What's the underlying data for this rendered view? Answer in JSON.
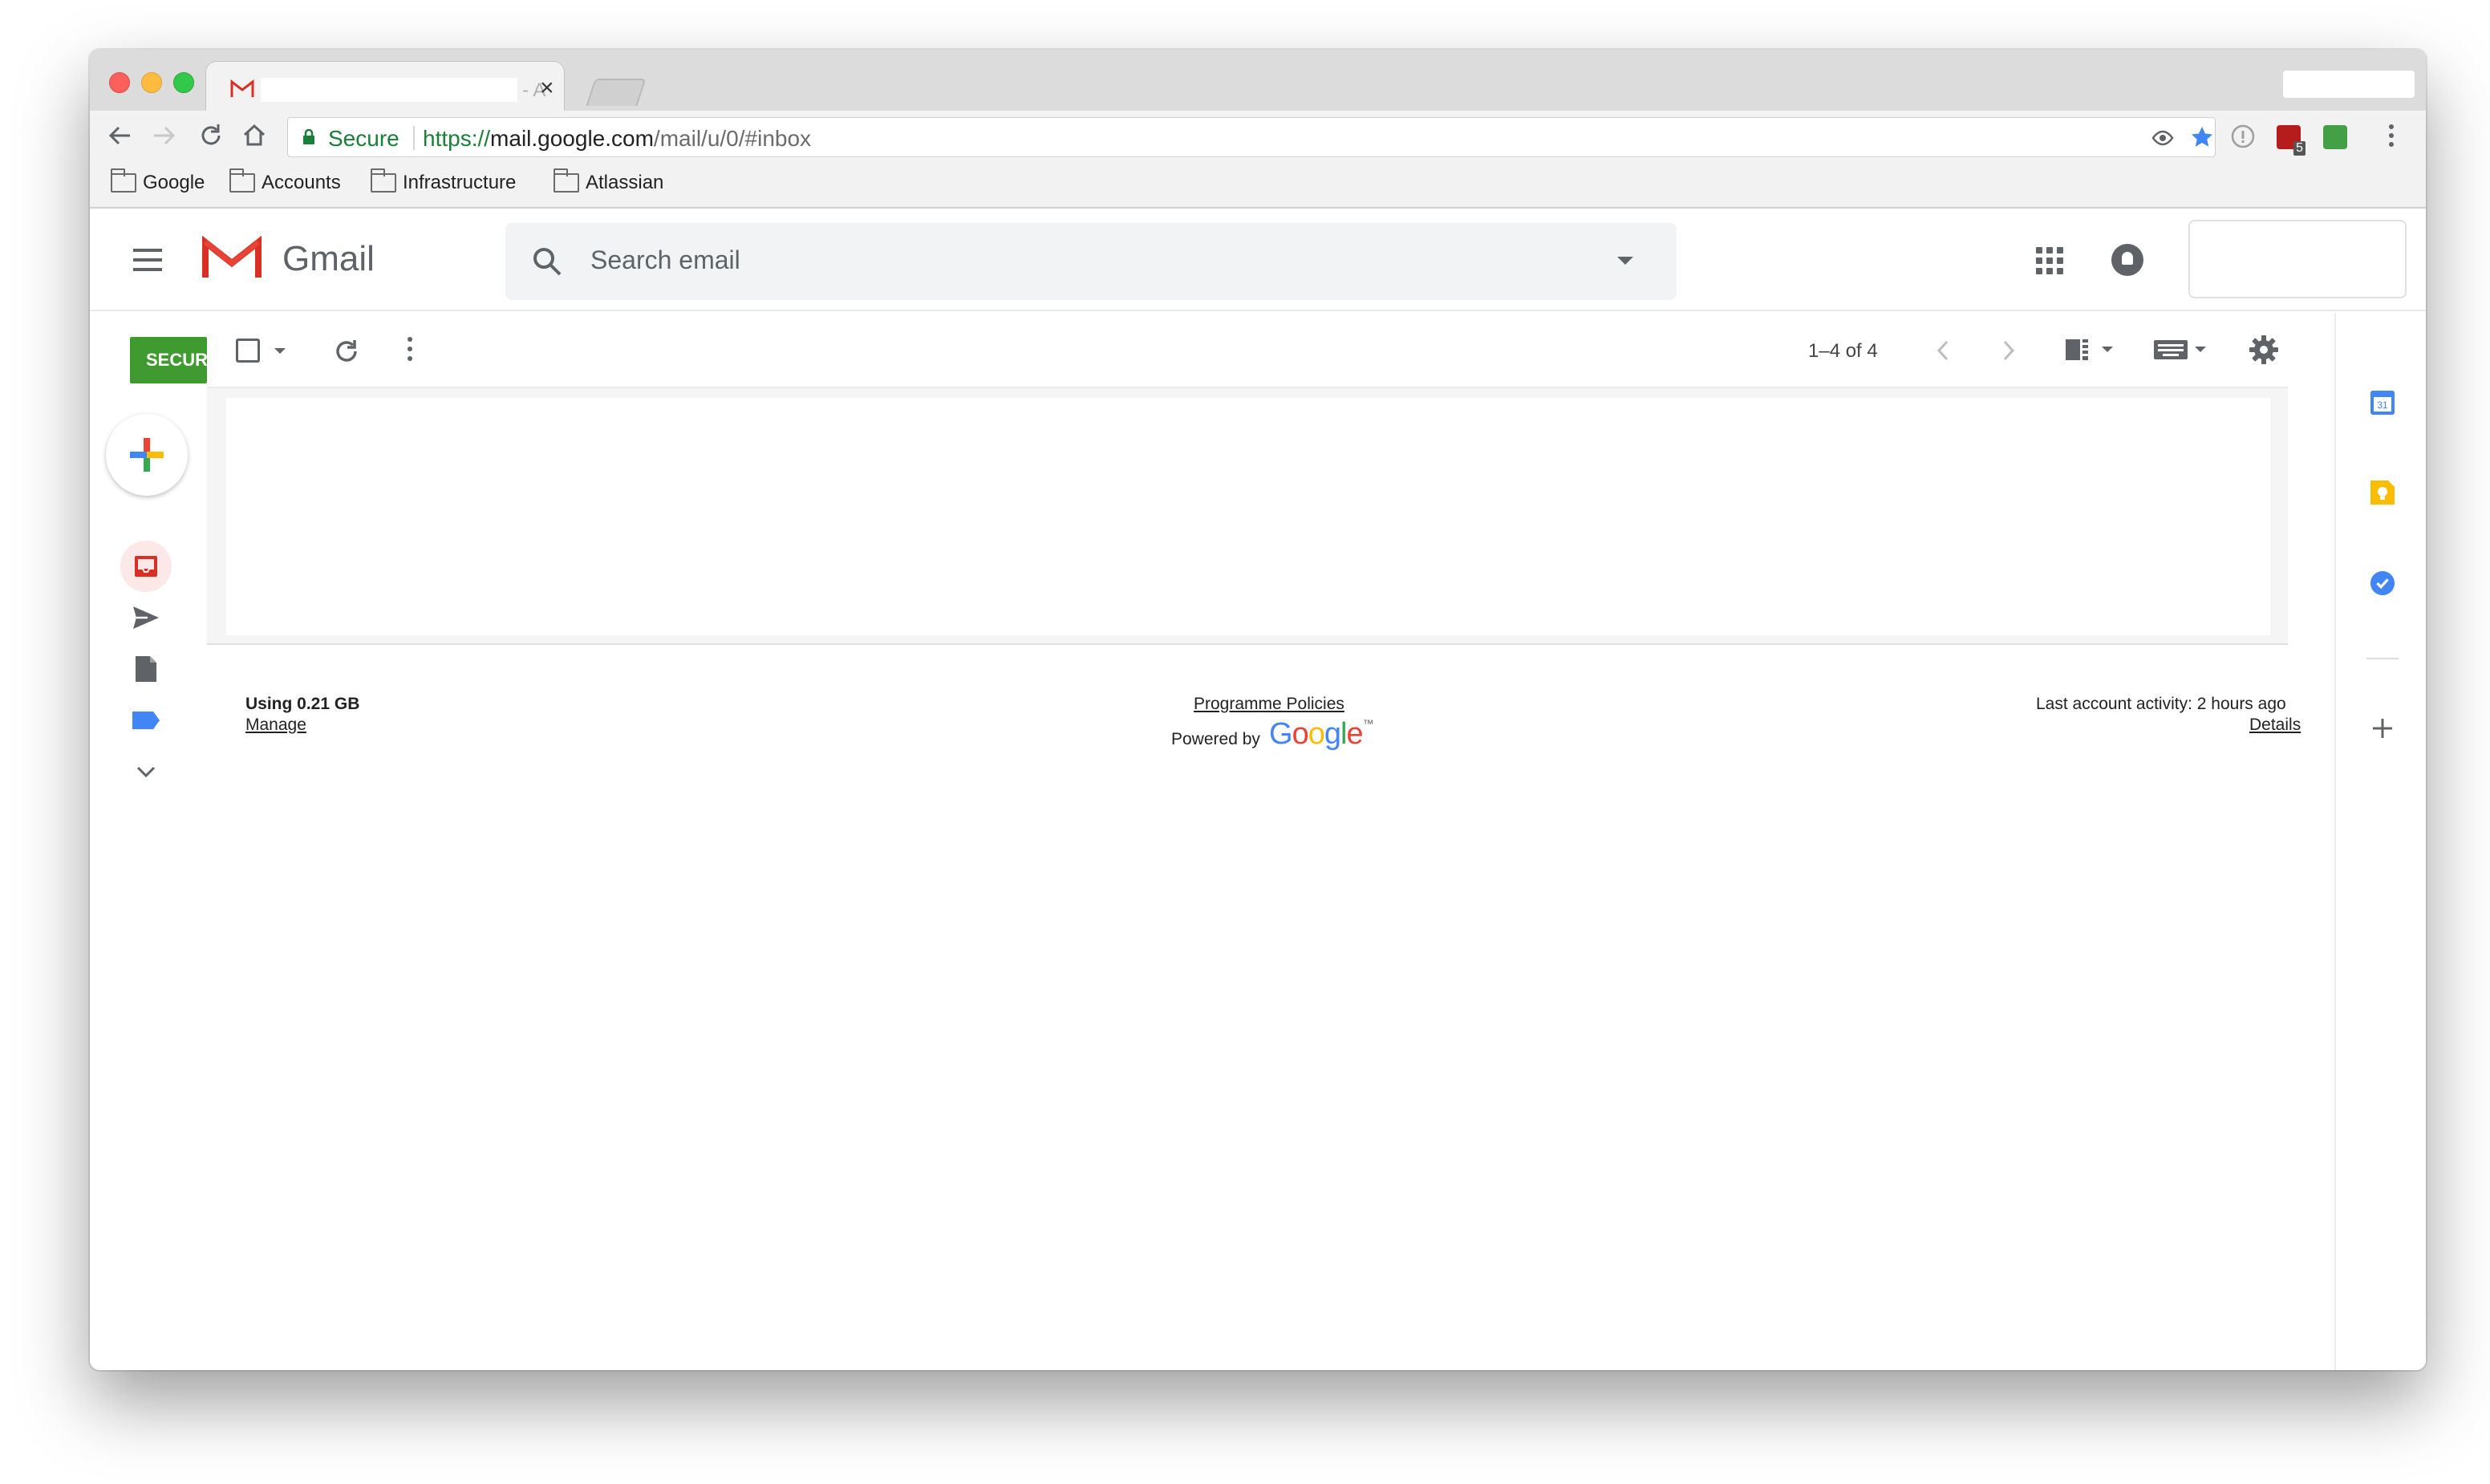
{
  "browser": {
    "tab": {
      "title_fragment": "- A",
      "close_glyph": "×"
    },
    "address": {
      "secure_label": "Secure",
      "url_protocol": "https://",
      "url_host": "mail.google.com",
      "url_path": "/mail/u/0/#inbox"
    },
    "bookmarks": [
      "Google",
      "Accounts",
      "Infrastructure",
      "Atlassian"
    ],
    "extensions": {
      "badge_count": "5"
    }
  },
  "gmail": {
    "brand": "Gmail",
    "search_placeholder": "Search email",
    "secure_badge": "SECURE",
    "toolbar": {
      "count": "1–4 of 4"
    },
    "footer": {
      "storage": "Using 0.21 GB",
      "manage": "Manage",
      "policies": "Programme Policies",
      "powered_by": "Powered by",
      "google_tm": "™",
      "last_activity": "Last account activity: 2 hours ago",
      "details": "Details"
    }
  },
  "icons": {
    "back": "back-arrow-icon",
    "forward": "forward-arrow-icon",
    "reload": "reload-icon",
    "home": "home-icon",
    "menu": "hamburger-icon",
    "search": "search-icon",
    "apps": "apps-grid-icon",
    "notifications": "bell-icon",
    "settings": "gear-icon"
  },
  "colors": {
    "gmail_red": "#ea4335",
    "secure_green": "#1a7f37",
    "badge_green": "#3f9b2f",
    "label_blue": "#4285f4"
  }
}
